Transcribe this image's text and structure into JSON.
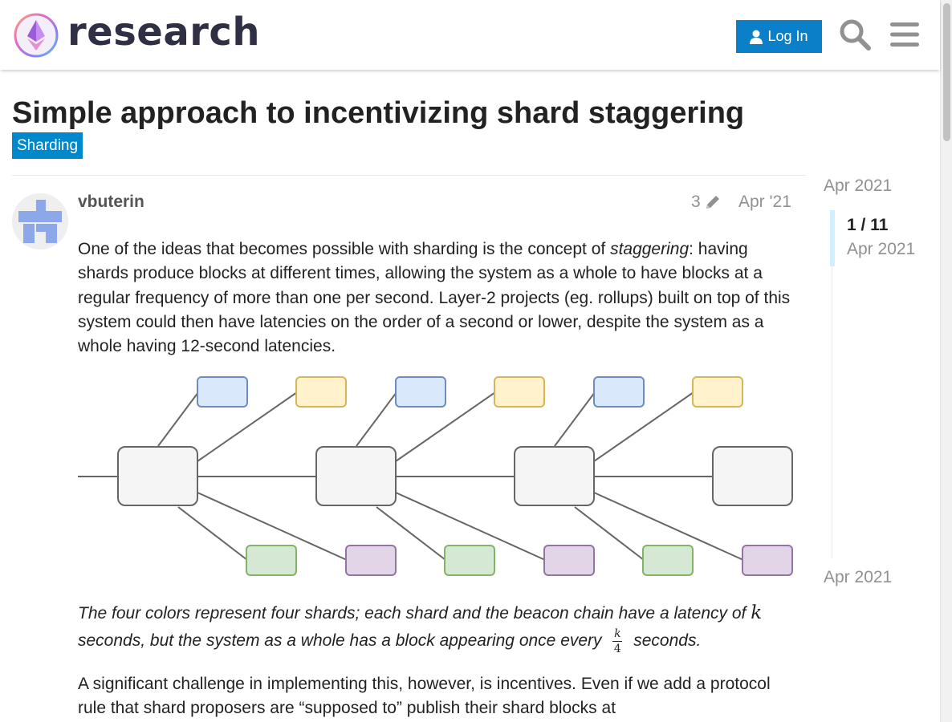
{
  "header": {
    "site_name": "research",
    "login_label": "Log In",
    "brand_color": "#0b80c9"
  },
  "topic": {
    "title": "Simple approach to incentivizing shard staggering",
    "category": "Sharding",
    "category_color": "#0088cc"
  },
  "post": {
    "username": "vbuterin",
    "edit_count": "3",
    "date": "Apr '21",
    "paragraph1": {
      "before": "One of the ideas that becomes possible with sharding is the concept of ",
      "emphasis": "staggering",
      "after": ": having shards produce blocks at different times, allowing the system as a whole to have blocks at a regular frequency of more than one per second. Layer-2 projects (eg. rollups) built on top of this system could then have latencies on the order of a second or lower, despite the system as a whole having 12-second latencies."
    },
    "caption": {
      "part1": "The four colors represent four shards; each shard and the beacon chain have a latency of ",
      "k": "k",
      "part2": "seconds, but the system as a whole has a block appearing once every ",
      "frac_num": "k",
      "frac_den": "4",
      "part3": " seconds."
    },
    "paragraph3": "A significant challenge in implementing this, however, is incentives. Even if we add a protocol rule that shard proposers are “supposed to” publish their shard blocks at"
  },
  "diagram": {
    "shard_colors": {
      "blue": {
        "fill": "#dae8fc",
        "stroke": "#6c8ebf"
      },
      "yellow": {
        "fill": "#fff2cc",
        "stroke": "#d6b656"
      },
      "green": {
        "fill": "#d5e8d4",
        "stroke": "#82b366"
      },
      "purple": {
        "fill": "#e1d5e7",
        "stroke": "#9673a6"
      },
      "beacon": {
        "fill": "#f5f5f5",
        "stroke": "#666666"
      }
    }
  },
  "timeline": {
    "top_date": "Apr 2021",
    "counter": "1 / 11",
    "handle_date": "Apr 2021",
    "bottom_date": "Apr 2021"
  }
}
